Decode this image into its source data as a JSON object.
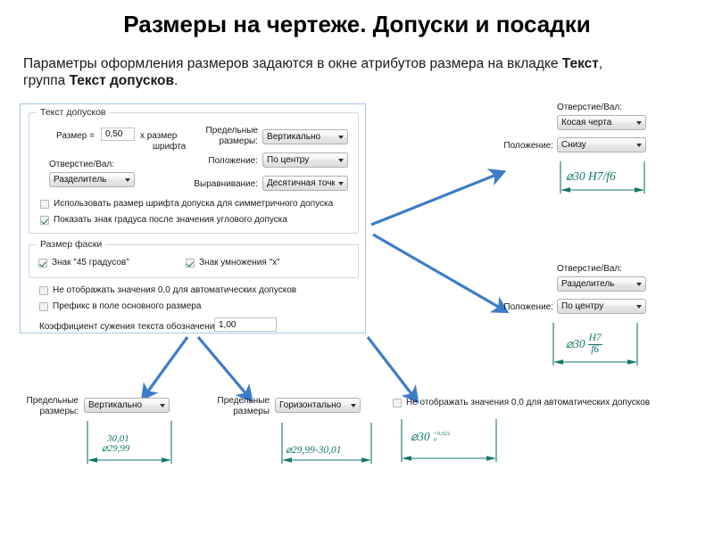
{
  "slide": {
    "title": "Размеры на чертеже. Допуски и посадки",
    "intro_part1": "Параметры оформления размеров задаются в окне атрибутов размера на вкладке ",
    "intro_bold1": "Текст",
    "intro_part2": ", группа ",
    "intro_bold2": "Текст допусков",
    "intro_part3": "."
  },
  "dialog": {
    "group_tolerance_text": {
      "legend": "Текст допусков",
      "size_label": "Размер =",
      "size_value": "0,50",
      "size_suffix_line1": "х  размер",
      "size_suffix_line2": "шрифта",
      "hole_shaft_label": "Отверстие/Вал:",
      "hole_shaft_value": "Разделитель",
      "limit_dims_label_line1": "Предельные",
      "limit_dims_label_line2": "размеры:",
      "limit_dims_value": "Вертикально",
      "position_label": "Положение:",
      "position_value": "По центру",
      "alignment_label": "Выравнивание:",
      "alignment_value": "Десятичная точка",
      "check_symmetric": {
        "label": "Использовать размер шрифта допуска для симметричного допуска",
        "checked": false
      },
      "check_degree": {
        "label": "Показать знак градуса после значения углового допуска",
        "checked": true
      }
    },
    "group_chamfer": {
      "legend": "Размер фаски",
      "check_45": {
        "label": "Знак \"45 градусов\"",
        "checked": true
      },
      "check_mult": {
        "label": "Знак умножения \"х\"",
        "checked": true
      }
    },
    "check_hide_zero": {
      "label": "Не отображать значения 0,0 для автоматических допусков",
      "checked": false
    },
    "check_prefix": {
      "label": "Префикс в поле основного размера",
      "checked": false
    },
    "coef_label": "Коэффициент сужения текста обозначения:",
    "coef_value": "1,00"
  },
  "panel_top_right": {
    "hole_shaft_label": "Отверстие/Вал:",
    "hole_shaft_value": "Косая черта",
    "position_label": "Положение:",
    "position_value": "Снизу",
    "dimension_text": "⌀30 H7/f6"
  },
  "panel_mid_right": {
    "hole_shaft_label": "Отверстие/Вал:",
    "hole_shaft_value": "Разделитель",
    "position_label": "Положение:",
    "position_value": "По центру",
    "dimension_prefix": "⌀30",
    "dimension_numerator": "H7",
    "dimension_denominator": "f6"
  },
  "panel_bottom_1": {
    "limit_dims_label_line1": "Предельные",
    "limit_dims_label_line2": "размеры:",
    "limit_dims_value": "Вертикально",
    "dimension_upper": "30,01",
    "dimension_lower": "⌀29,99"
  },
  "panel_bottom_2": {
    "limit_dims_label_line1": "Предельные",
    "limit_dims_label_line2": "размеры",
    "limit_dims_value": "Горизонтально",
    "dimension_text": "⌀29,99-30,01"
  },
  "panel_bottom_3": {
    "check_hide_zero": {
      "label": "Не отображать значения 0,0 для автоматических допусков",
      "checked": false
    },
    "dimension_base": "⌀30",
    "dimension_upper_dev": "+0,021",
    "dimension_lower_dev": "0"
  },
  "colors": {
    "dialog_border": "#a8c9e8",
    "arrow_blue": "#3d7cc9",
    "dimension_teal": "#14776c",
    "title_text": "#000000"
  }
}
